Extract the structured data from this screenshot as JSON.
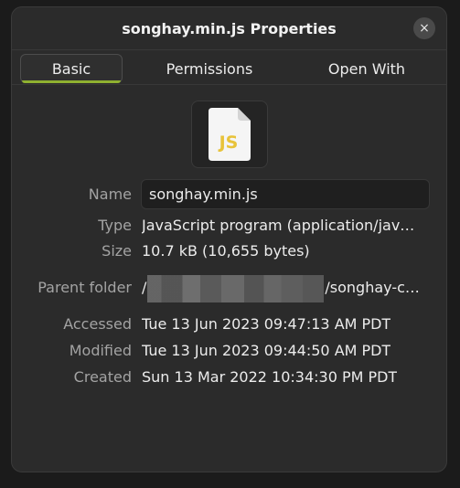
{
  "window": {
    "title": "songhay.min.js Properties",
    "close_glyph": "×"
  },
  "tabs": [
    {
      "label": "Basic",
      "active": true
    },
    {
      "label": "Permissions",
      "active": false
    },
    {
      "label": "Open With",
      "active": false
    }
  ],
  "file_icon": {
    "name": "js-file-icon",
    "text": "JS",
    "color": "#e8c33a"
  },
  "properties": {
    "name_label": "Name",
    "name_value": "songhay.min.js",
    "type_label": "Type",
    "type_value": "JavaScript program (application/jav…",
    "size_label": "Size",
    "size_value": "10.7 kB (10,655 bytes)",
    "parent_label": "Parent folder",
    "parent_prefix": "/",
    "parent_suffix": "/songhay-c…",
    "accessed_label": "Accessed",
    "accessed_value": "Tue 13 Jun 2023 09:47:13 AM PDT",
    "modified_label": "Modified",
    "modified_value": "Tue 13 Jun 2023 09:44:50 AM PDT",
    "created_label": "Created",
    "created_value": "Sun 13 Mar 2022 10:34:30 PM PDT"
  }
}
